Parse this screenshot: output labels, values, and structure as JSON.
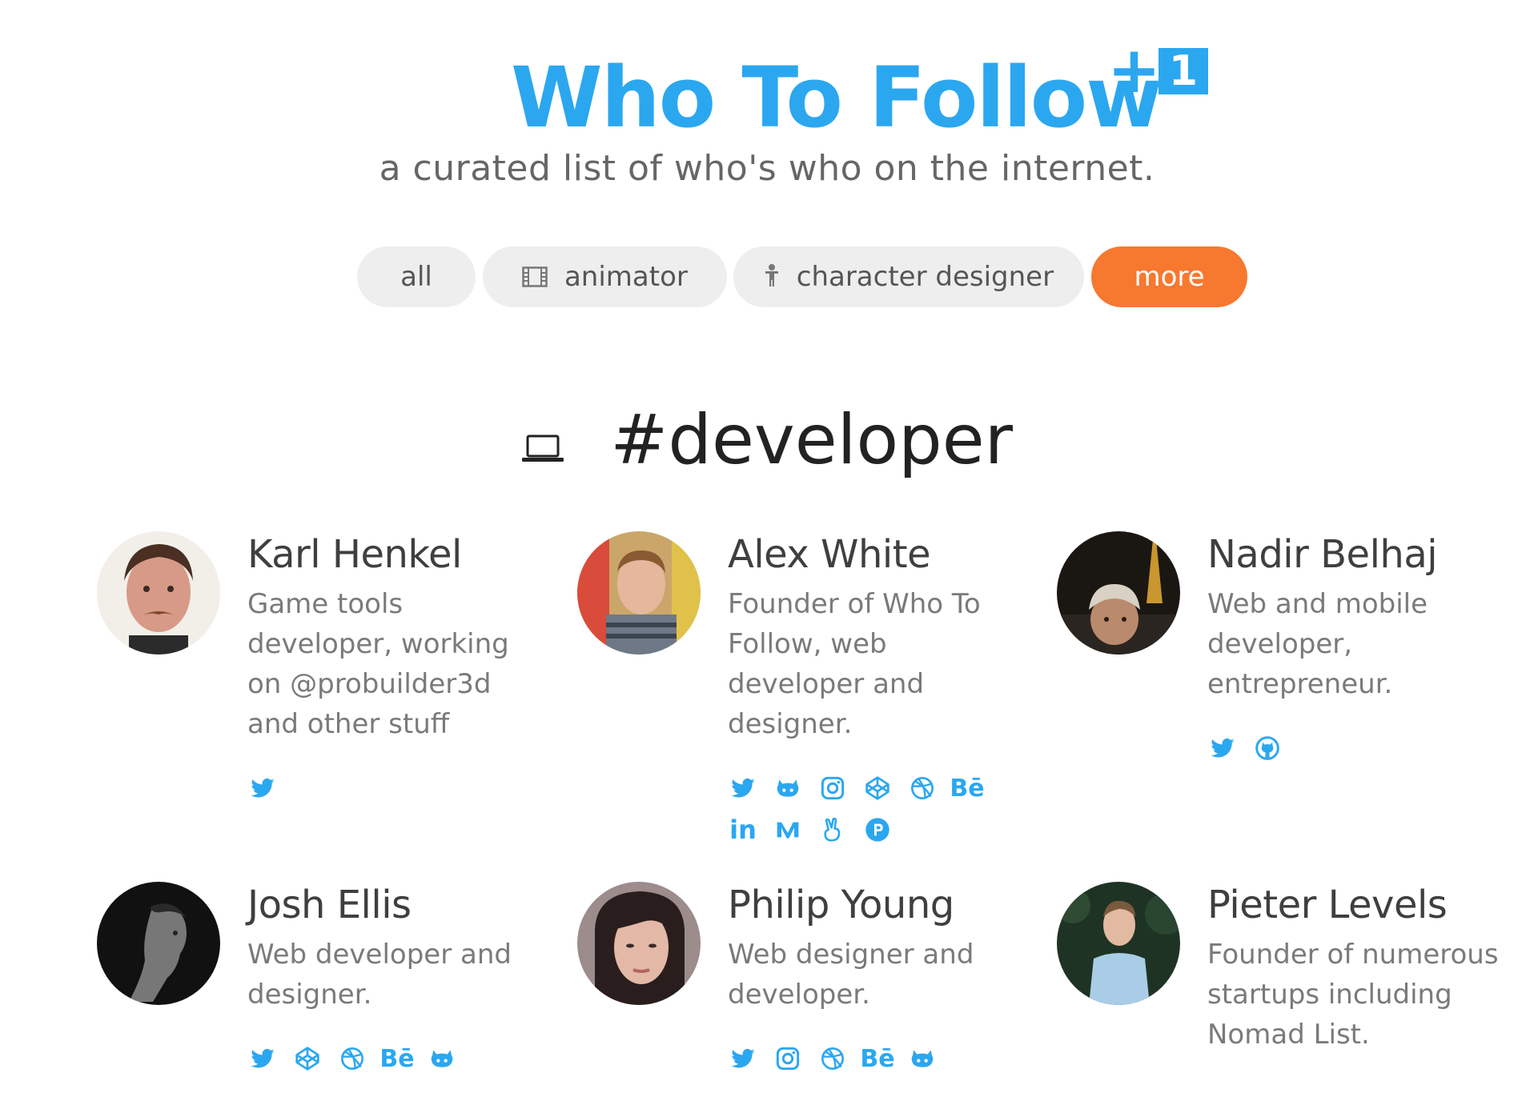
{
  "header": {
    "title": "Who To Follow",
    "badge_plus": "+",
    "badge_one": "1",
    "subtitle": "a curated list of who's who on the internet."
  },
  "filters": [
    {
      "label": "all",
      "icon": ""
    },
    {
      "label": "animator",
      "icon": "film-icon"
    },
    {
      "label": "character designer",
      "icon": "figure-icon"
    },
    {
      "label": "more",
      "icon": ""
    }
  ],
  "section": {
    "title": "#developer",
    "icon": "laptop-icon"
  },
  "people": [
    {
      "name": "Karl Henkel",
      "bio": "Game tools developer, working on @probuilder3d and other stuff",
      "socials": [
        "twitter"
      ]
    },
    {
      "name": "Alex White",
      "bio": "Founder of Who To Follow, web developer and designer.",
      "socials": [
        "twitter",
        "github",
        "instagram",
        "codepen",
        "dribbble",
        "behance",
        "linkedin",
        "medium",
        "angellist",
        "producthunt"
      ]
    },
    {
      "name": "Nadir Belhaj",
      "bio": "Web and mobile developer, entrepreneur.",
      "socials": [
        "twitter",
        "github"
      ]
    },
    {
      "name": "Josh Ellis",
      "bio": "Web developer and designer.",
      "socials": [
        "twitter",
        "codepen",
        "dribbble",
        "behance",
        "github"
      ]
    },
    {
      "name": "Philip Young",
      "bio": "Web designer and developer.",
      "socials": [
        "twitter",
        "instagram",
        "dribbble",
        "behance",
        "github"
      ]
    },
    {
      "name": "Pieter Levels",
      "bio": "Founder of numerous startups including Nomad List.",
      "socials": []
    }
  ],
  "colors": {
    "accent": "#2ba7f0",
    "more_pill": "#f7782f",
    "pill_bg": "#eeeeee"
  }
}
